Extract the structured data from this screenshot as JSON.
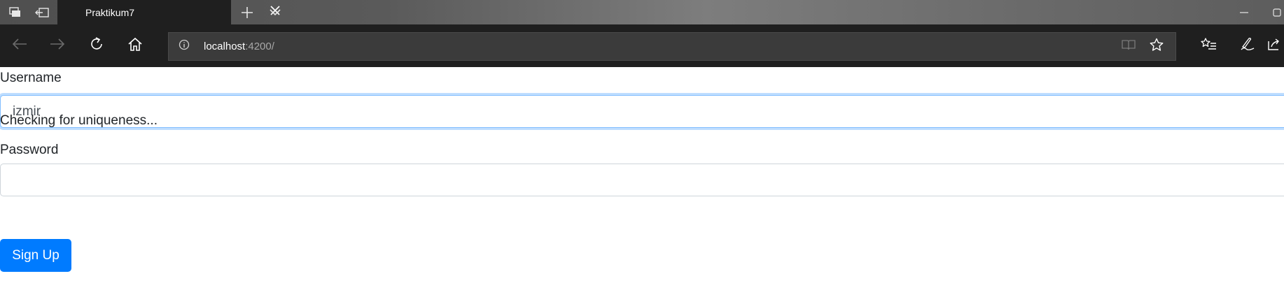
{
  "browser": {
    "tab": {
      "title": "Praktikum7"
    },
    "address": {
      "host": "localhost",
      "rest": ":4200/"
    },
    "icons": {
      "tabs_aside": "tabs-aside-icon",
      "set_tabs_aside": "set-tabs-aside-icon",
      "close_tab": "close-icon",
      "new_tab": "plus-icon",
      "tab_list": "chevron-down-icon",
      "minimize": "minimize-icon",
      "maximize": "maximize-icon",
      "back": "back-arrow-icon",
      "forward": "forward-arrow-icon",
      "refresh": "refresh-icon",
      "home": "home-icon",
      "site_info": "info-icon",
      "reading_view": "book-icon",
      "favorite": "star-icon",
      "favorites_hub": "favorites-list-icon",
      "web_note": "pen-icon",
      "share": "share-icon"
    }
  },
  "form": {
    "username": {
      "label": "Username",
      "value": "izmir"
    },
    "uniqueness_status": "Checking for uniqueness...",
    "password": {
      "label": "Password",
      "value": ""
    },
    "submit_label": "Sign Up"
  },
  "colors": {
    "primary": "#007bff",
    "focus_border": "#80bdff",
    "browser_chrome": "#1f1f1f"
  }
}
